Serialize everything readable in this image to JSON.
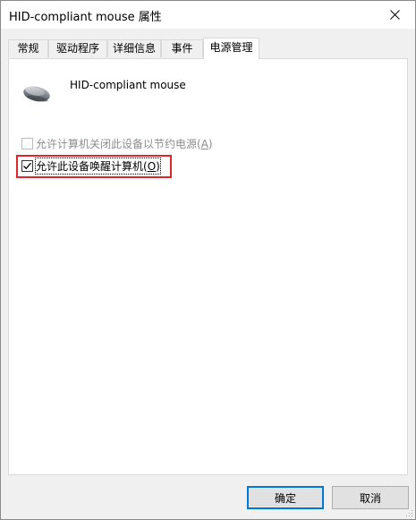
{
  "window": {
    "title": "HID-compliant mouse 属性"
  },
  "tabs": [
    {
      "label": "常规",
      "active": false
    },
    {
      "label": "驱动程序",
      "active": false
    },
    {
      "label": "详细信息",
      "active": false
    },
    {
      "label": "事件",
      "active": false
    },
    {
      "label": "电源管理",
      "active": true
    }
  ],
  "device": {
    "name": "HID-compliant mouse",
    "icon": "mouse-icon"
  },
  "options": {
    "allow_turn_off": {
      "label": "允许计算机关闭此设备以节约电源(",
      "mnemonic": "A",
      "suffix": ")",
      "checked": false,
      "enabled": false
    },
    "allow_wake": {
      "label": "允许此设备唤醒计算机(",
      "mnemonic": "O",
      "suffix": ")",
      "checked": true,
      "enabled": true
    }
  },
  "buttons": {
    "ok": "确定",
    "cancel": "取消"
  },
  "colors": {
    "highlight": "#e0262b",
    "default_button_border": "#0078d7",
    "panel_bg": "#ffffff",
    "window_bg": "#f0f0f0"
  }
}
